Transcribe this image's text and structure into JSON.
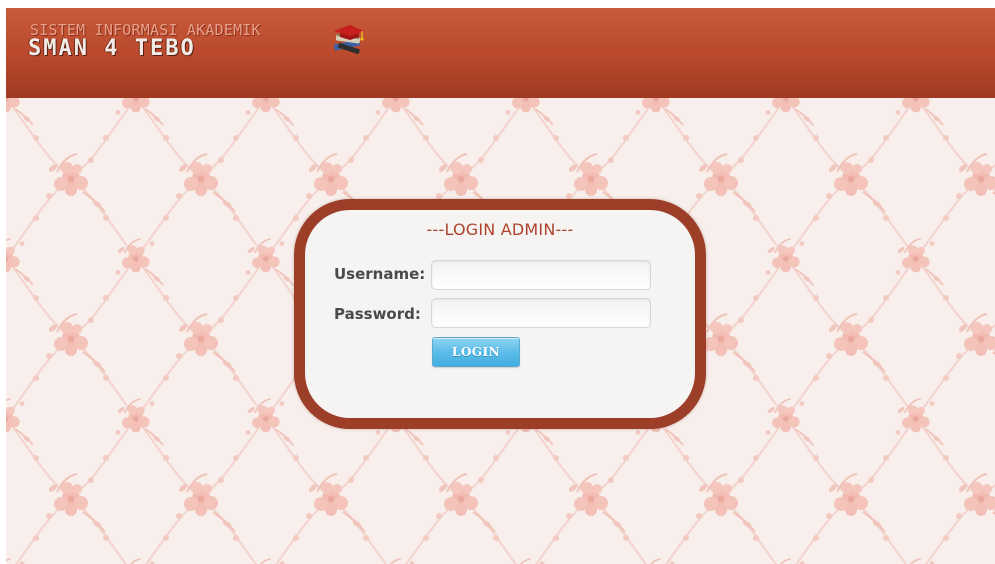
{
  "header": {
    "subtitle": "SISTEM INFORMASI AKADEMIK",
    "title": "SMAN 4  TEBO",
    "logo_icon": "books-graduation-cap-icon"
  },
  "login": {
    "title": "---LOGIN ADMIN---",
    "username_label": "Username:",
    "username_value": "",
    "password_label": "Password:",
    "password_value": "",
    "button_label": "LOGIN"
  },
  "colors": {
    "header": "#b9482c",
    "box_border": "#9c3e28",
    "title_text": "#b0432b",
    "button": "#5cbde9",
    "wallpaper_flowers": "#f0b8ae",
    "wallpaper_bg": "#f8efec"
  }
}
